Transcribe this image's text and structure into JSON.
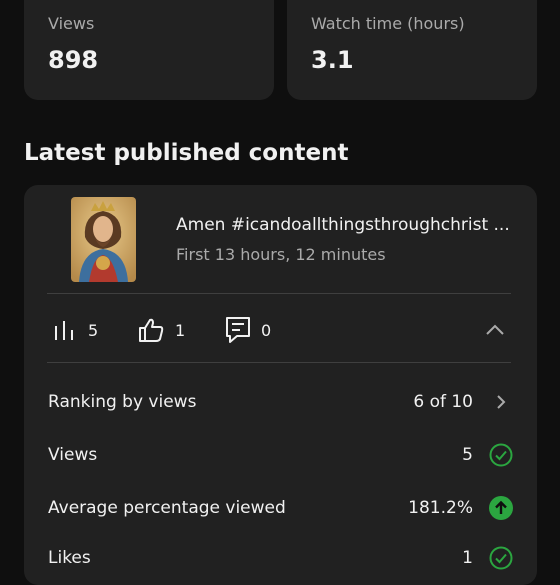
{
  "stats": {
    "views_label": "Views",
    "views_value": "898",
    "watch_label": "Watch time (hours)",
    "watch_value": "3.1"
  },
  "section_title": "Latest published content",
  "video": {
    "title": "Amen #icandoallthingsthroughchrist ...",
    "subtitle": "First 13 hours, 12 minutes",
    "views_count": "5",
    "likes_count": "1",
    "comments_count": "0"
  },
  "rows": [
    {
      "label": "Ranking by views",
      "value": "6 of 10",
      "icon": "chevron-right-icon"
    },
    {
      "label": "Views",
      "value": "5",
      "icon": "check-circle-icon"
    },
    {
      "label": "Average percentage viewed",
      "value": "181.2%",
      "icon": "arrow-up-circle-icon"
    },
    {
      "label": "Likes",
      "value": "1",
      "icon": "check-circle-icon"
    }
  ],
  "colors": {
    "background": "#0f0f0f",
    "card": "#212121",
    "success_green": "#2ba640",
    "muted_text": "#aaaaaa"
  }
}
